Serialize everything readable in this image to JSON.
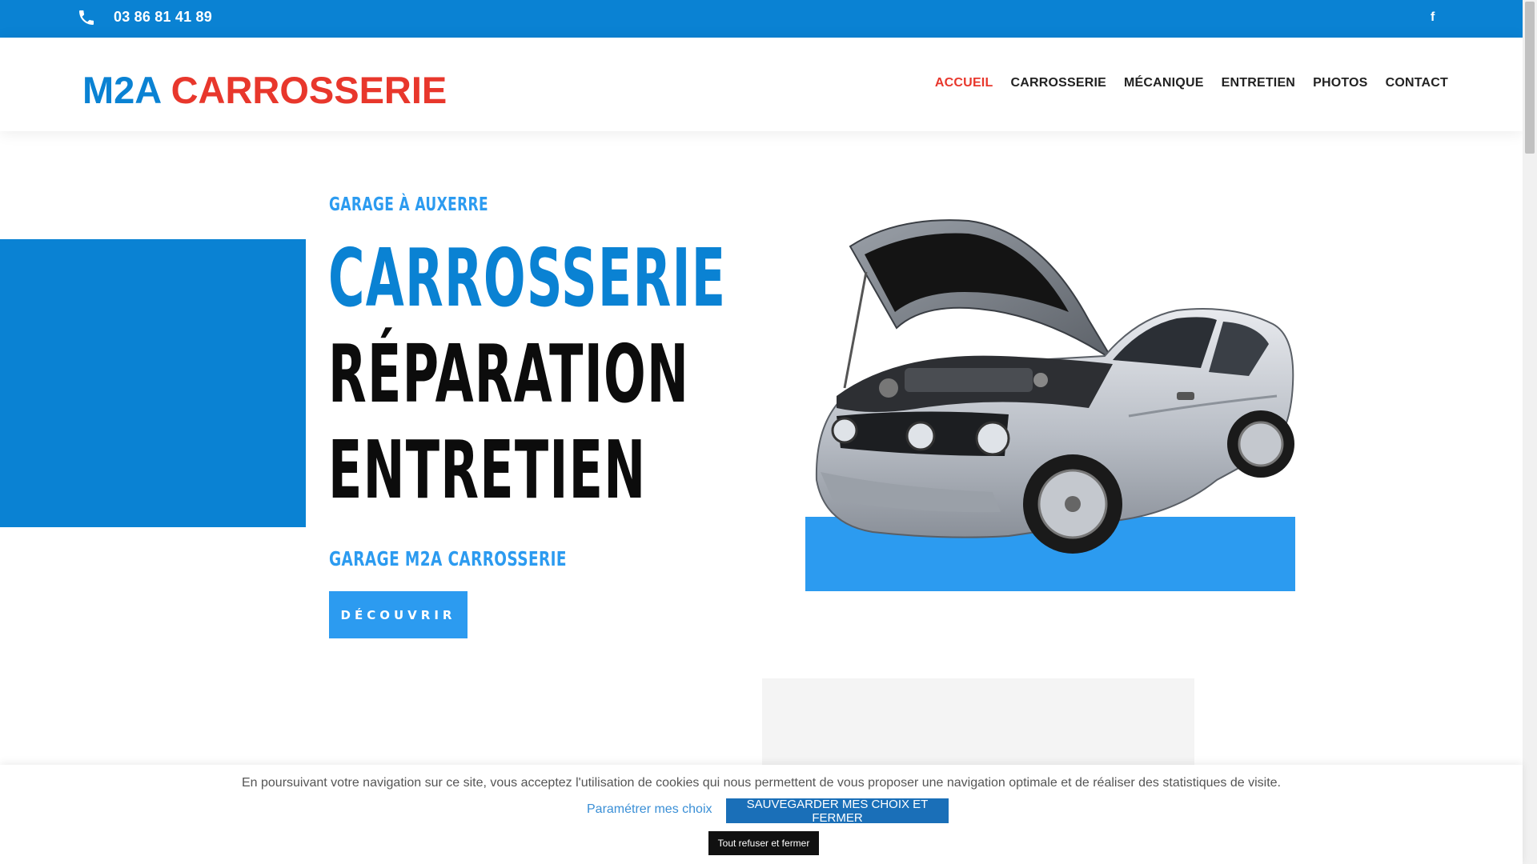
{
  "topbar": {
    "phone": "03 86 81 41 89",
    "social_icon": "facebook-icon"
  },
  "header": {
    "logo_part1": "M2A",
    "logo_part2": "CARROSSERIE",
    "nav": [
      {
        "label": "ACCUEIL",
        "active": true
      },
      {
        "label": "CARROSSERIE",
        "active": false
      },
      {
        "label": "MÉCANIQUE",
        "active": false
      },
      {
        "label": "ENTRETIEN",
        "active": false
      },
      {
        "label": "PHOTOS",
        "active": false
      },
      {
        "label": "CONTACT",
        "active": false
      }
    ]
  },
  "hero": {
    "kicker": "GARAGE À AUXERRE",
    "line1": "CARROSSERIE",
    "line2": "RÉPARATION",
    "line3": "ENTRETIEN",
    "subtitle": "GARAGE M2A CARROSSERIE",
    "button": "DÉCOUVRIR"
  },
  "cookie": {
    "text": "En poursuivant votre navigation sur ce site, vous acceptez l'utilisation de cookies qui nous permettent de vous proposer une navigation optimale et de réaliser des statistiques de visite.",
    "settings_link": "Paramétrer mes choix",
    "save_button": "SAUVEGARDER MES CHOIX ET FERMER",
    "refuse_button": "Tout refuser et fermer"
  },
  "colors": {
    "brand_blue": "#0a82d3",
    "light_blue": "#2c9bf0",
    "accent_red": "#e8372c"
  }
}
